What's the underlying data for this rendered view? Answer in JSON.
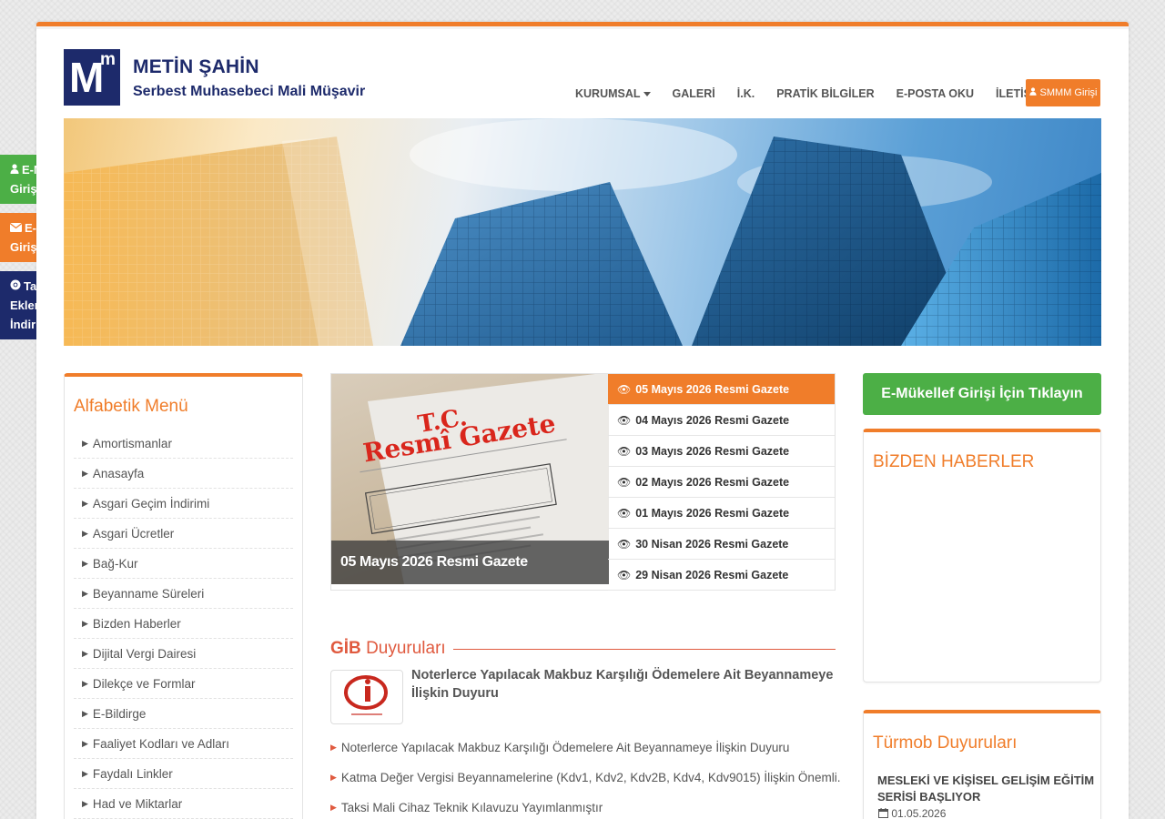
{
  "brand": {
    "logo_big": "M",
    "logo_small": "m",
    "name": "METİN ŞAHİN",
    "subtitle": "Serbest Muhasebeci Mali Müşavir"
  },
  "nav": {
    "items": [
      "KURUMSAL",
      "GALERİ",
      "İ.K.",
      "PRATİK BİLGİLER",
      "E-POSTA OKU",
      "İLETİŞİM"
    ],
    "smmm_button": "SMMM Girişi"
  },
  "side_buttons": {
    "emukellef_line1": "E-Mükellef",
    "emukellef_line2": "Girişi",
    "eposta_line1": "E-posta",
    "eposta_line2": "Girişi",
    "tarayici_line1": "Tarayıcı",
    "tarayici_line2": "Eklentimizi",
    "tarayici_line3": "İndirin"
  },
  "alphabetic_menu": {
    "title": "Alfabetik Menü",
    "items": [
      "Amortismanlar",
      "Anasayfa",
      "Asgari Geçim İndirimi",
      "Asgari Ücretler",
      "Bağ-Kur",
      "Beyanname Süreleri",
      "Bizden Haberler",
      "Dijital Vergi Dairesi",
      "Dilekçe ve Formlar",
      "E-Bildirge",
      "Faaliyet Kodları ve Adları",
      "Faydalı Linkler",
      "Had ve Miktarlar"
    ]
  },
  "gazette": {
    "image_title_line1": "T.C.",
    "image_title_line2": "Resmî Gazete",
    "caption": "05 Mayıs 2026 Resmi Gazete",
    "items": [
      "05 Mayıs 2026 Resmi Gazete",
      "04 Mayıs 2026 Resmi Gazete",
      "03 Mayıs 2026 Resmi Gazete",
      "02 Mayıs 2026 Resmi Gazete",
      "01 Mayıs 2026 Resmi Gazete",
      "30 Nisan 2026 Resmi Gazete",
      "29 Nisan 2026 Resmi Gazete"
    ],
    "active_index": 0
  },
  "gib": {
    "title_bold": "GİB",
    "title_rest": "Duyuruları",
    "featured": "Noterlerce Yapılacak Makbuz Karşılığı Ödemelere Ait Beyannameye İlişkin Duyuru",
    "items": [
      "Noterlerce Yapılacak Makbuz Karşılığı Ödemelere Ait Beyannameye İlişkin Duyuru",
      "Katma Değer Vergisi Beyannamelerine (Kdv1, Kdv2, Kdv2B, Kdv4, Kdv9015) İlişkin Önemli...",
      "Taksi Mali Cihaz Teknik Kılavuzu Yayımlanmıştır"
    ]
  },
  "right": {
    "emukellef_button": "E-Mükellef Girişi İçin Tıklayın",
    "news_title": "BİZDEN HABERLER",
    "turmob_title": "Türmob Duyuruları",
    "turmob_item": "MESLEKİ VE KİŞİSEL GELİŞİM EĞİTİM SERİSİ BAŞLIYOR",
    "turmob_date": "01.05.2026"
  },
  "colors": {
    "accent": "#f07d2a",
    "navy": "#1d2a6b",
    "green": "#4caf46",
    "gib_red": "#e05a3f"
  },
  "icons": {
    "user": "user-icon",
    "mail": "envelope-icon",
    "browser": "chrome-icon",
    "eye": "eye-icon",
    "caret": "caret-right-icon",
    "calendar": "calendar-icon"
  }
}
